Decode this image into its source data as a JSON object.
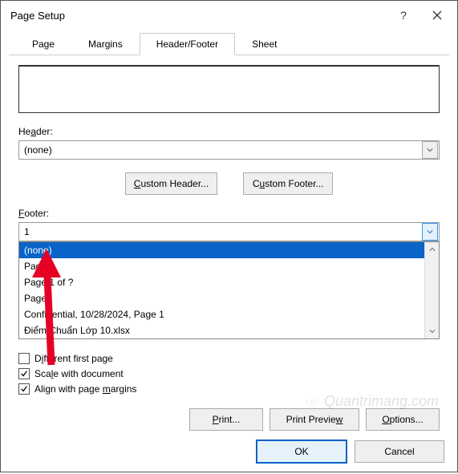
{
  "window": {
    "title": "Page Setup"
  },
  "tabs": [
    {
      "label": "Page"
    },
    {
      "label": "Margins"
    },
    {
      "label": "Header/Footer"
    },
    {
      "label": "Sheet"
    }
  ],
  "header_section": {
    "label": "Header:",
    "value": "(none)"
  },
  "custom_buttons": {
    "header": "Custom Header...",
    "footer": "Custom Footer..."
  },
  "footer_section": {
    "label": "Footer:",
    "value": "1"
  },
  "footer_options": [
    "(none)",
    "Page 1",
    "Page 1 of ?",
    "Page1",
    "  Confidential, 10/28/2024, Page 1",
    "Điểm Chuẩn Lớp 10.xlsx"
  ],
  "checkboxes": {
    "diff_first": {
      "label": "Different first page",
      "checked": false
    },
    "scale": {
      "label": "Scale with document",
      "checked": true
    },
    "align": {
      "label": "Align with page margins",
      "checked": true
    }
  },
  "action_buttons": {
    "print": "Print...",
    "preview": "Print Preview",
    "options": "Options..."
  },
  "dialog_buttons": {
    "ok": "OK",
    "cancel": "Cancel"
  },
  "watermark": "Quantrimang.com"
}
